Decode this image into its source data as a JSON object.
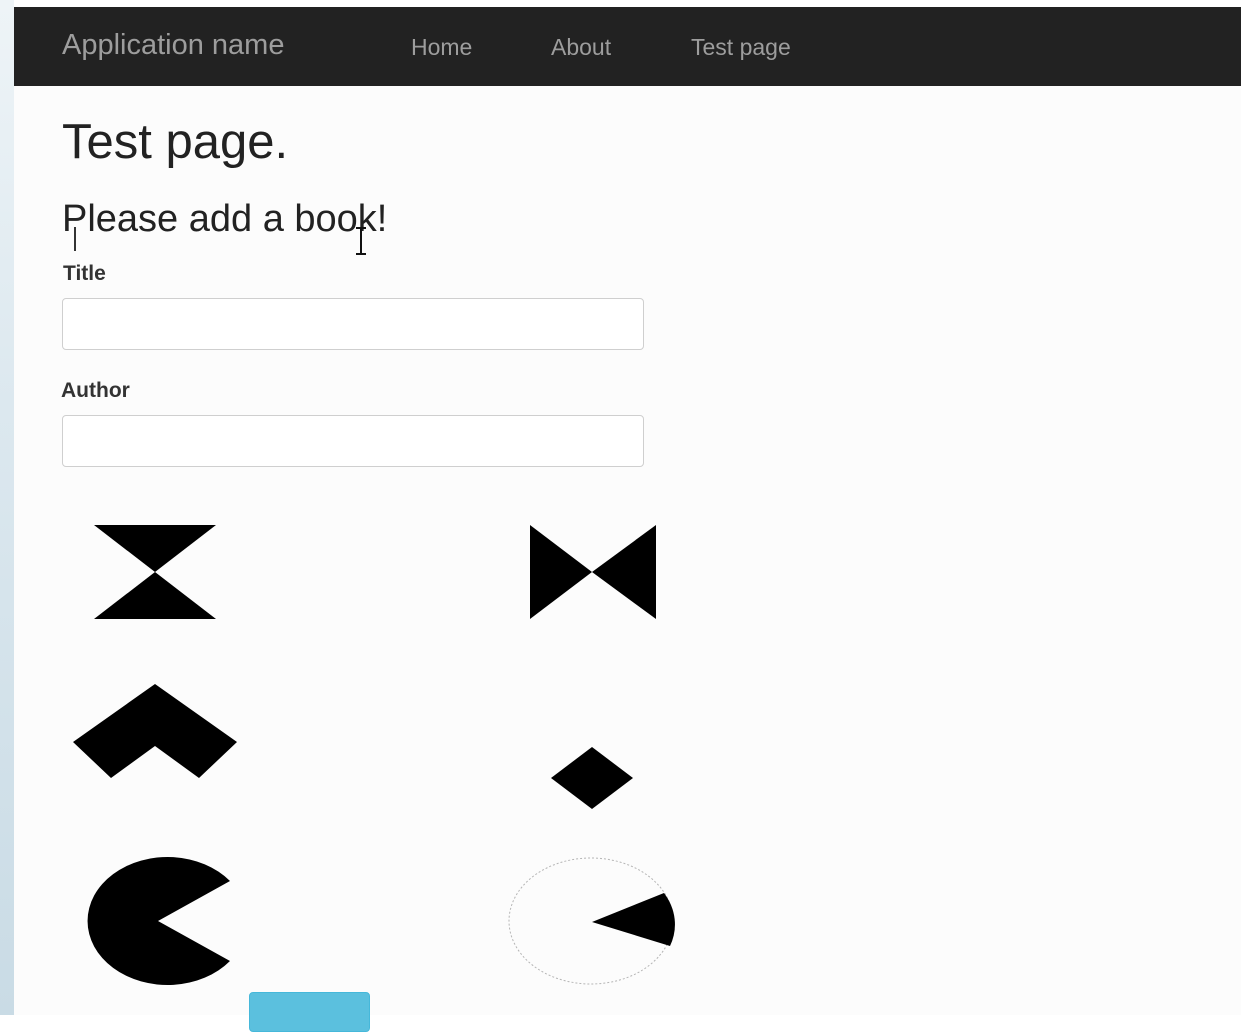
{
  "navbar": {
    "brand": "Application name",
    "links": [
      {
        "label": "Home"
      },
      {
        "label": "About"
      },
      {
        "label": "Test page"
      }
    ]
  },
  "page": {
    "title": "Test page.",
    "form_title": "Please add a book!"
  },
  "form": {
    "title_field": {
      "label": "Title",
      "value": ""
    },
    "author_field": {
      "label": "Author",
      "value": ""
    }
  },
  "shapes": [
    "hourglass-icon",
    "bowtie-icon",
    "chevron-up-icon",
    "diamond-icon",
    "pacman-icon",
    "dashed-circle-wedge-icon"
  ],
  "colors": {
    "navbar_bg": "#222222",
    "nav_text": "#9d9d9d",
    "shape_fill": "#000000",
    "button_bg": "#5bc0de"
  }
}
